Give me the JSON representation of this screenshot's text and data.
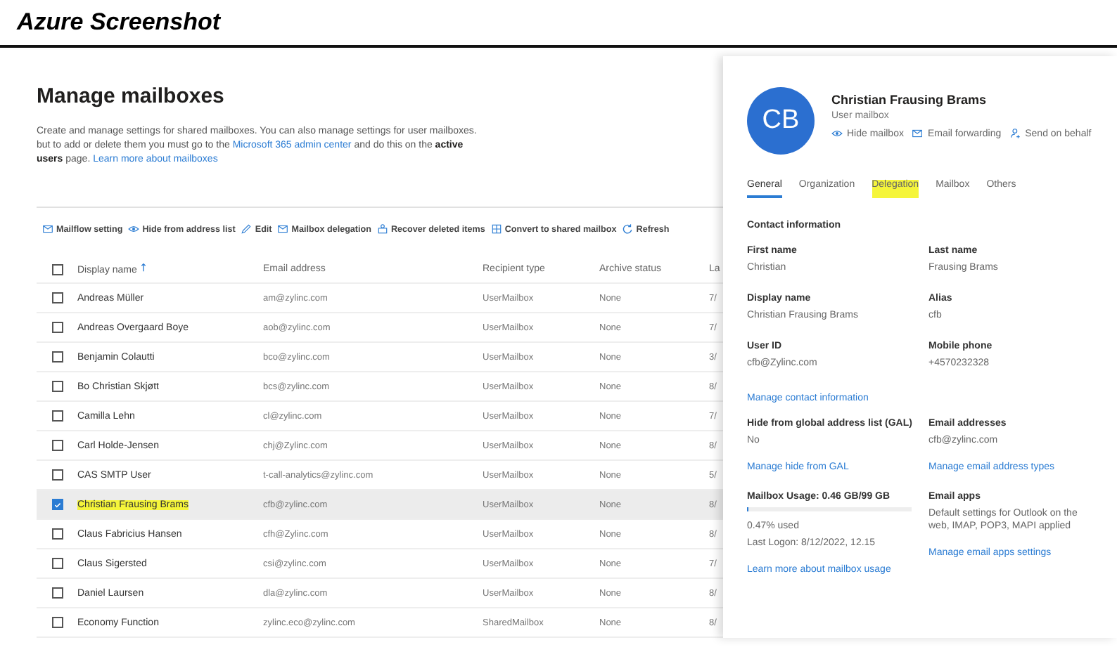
{
  "header": {
    "title": "Azure Screenshot"
  },
  "page": {
    "title": "Manage mailboxes",
    "description": [
      {
        "kind": "text",
        "text": "Create and manage settings for shared mailboxes. You can also manage settings for user mailboxes. but to add or delete them you must go to the "
      },
      {
        "kind": "link",
        "text": "Microsoft 365 admin center"
      },
      {
        "kind": "text",
        "text": " and do this on the **active users** page. "
      },
      {
        "kind": "link",
        "text": "Learn more about mailboxes"
      }
    ]
  },
  "toolbar": [
    {
      "kind": "mailflow",
      "label": "Mailflow setting"
    },
    {
      "kind": "hide",
      "label": "Hide from address list"
    },
    {
      "kind": "edit",
      "label": "Edit"
    },
    {
      "kind": "delegation",
      "label": "Mailbox delegation"
    },
    {
      "kind": "recover",
      "label": "Recover deleted items"
    },
    {
      "kind": "convert",
      "label": "Convert to shared mailbox"
    },
    {
      "kind": "refresh",
      "label": "Refresh"
    }
  ],
  "table": {
    "all_selected": false,
    "columns": [
      {
        "label": "Display name",
        "sorted": true
      },
      {
        "label": "Email address",
        "sorted": false
      },
      {
        "label": "Recipient type",
        "sorted": false
      },
      {
        "label": "Archive status",
        "sorted": false
      },
      {
        "label": "La",
        "sorted": false
      }
    ],
    "rows": [
      {
        "selected": false,
        "highlighted": false,
        "cells": [
          "Andreas Müller",
          "am@zylinc.com",
          "UserMailbox",
          "None",
          "7/"
        ]
      },
      {
        "selected": false,
        "highlighted": false,
        "cells": [
          "Andreas Overgaard Boye",
          "aob@zylinc.com",
          "UserMailbox",
          "None",
          "7/"
        ]
      },
      {
        "selected": false,
        "highlighted": false,
        "cells": [
          "Benjamin Colautti",
          "bco@zylinc.com",
          "UserMailbox",
          "None",
          "3/"
        ]
      },
      {
        "selected": false,
        "highlighted": false,
        "cells": [
          "Bo Christian Skjøtt",
          "bcs@zylinc.com",
          "UserMailbox",
          "None",
          "8/"
        ]
      },
      {
        "selected": false,
        "highlighted": false,
        "cells": [
          "Camilla Lehn",
          "cl@zylinc.com",
          "UserMailbox",
          "None",
          "7/"
        ]
      },
      {
        "selected": false,
        "highlighted": false,
        "cells": [
          "Carl Holde-Jensen",
          "chj@Zylinc.com",
          "UserMailbox",
          "None",
          "8/"
        ]
      },
      {
        "selected": false,
        "highlighted": false,
        "cells": [
          "CAS SMTP User",
          "t-call-analytics@zylinc.com",
          "UserMailbox",
          "None",
          "5/"
        ]
      },
      {
        "selected": true,
        "highlighted": true,
        "cells": [
          "Christian Frausing Brams",
          "cfb@zylinc.com",
          "UserMailbox",
          "None",
          "8/"
        ]
      },
      {
        "selected": false,
        "highlighted": false,
        "cells": [
          "Claus Fabricius Hansen",
          "cfh@Zylinc.com",
          "UserMailbox",
          "None",
          "8/"
        ]
      },
      {
        "selected": false,
        "highlighted": false,
        "cells": [
          "Claus Sigersted",
          "csi@zylinc.com",
          "UserMailbox",
          "None",
          "7/"
        ]
      },
      {
        "selected": false,
        "highlighted": false,
        "cells": [
          "Daniel Laursen",
          "dla@zylinc.com",
          "UserMailbox",
          "None",
          "8/"
        ]
      },
      {
        "selected": false,
        "highlighted": false,
        "cells": [
          "Economy Function",
          "zylinc.eco@zylinc.com",
          "SharedMailbox",
          "None",
          "8/"
        ]
      }
    ]
  },
  "panel": {
    "initials": "CB",
    "name": "Christian Frausing Brams",
    "subtitle": "User mailbox",
    "actions": [
      {
        "kind": "hide",
        "label": "Hide mailbox"
      },
      {
        "kind": "forward",
        "label": "Email forwarding"
      },
      {
        "kind": "behalf",
        "label": "Send on behalf"
      }
    ],
    "tabs": [
      {
        "label": "General",
        "selected": true,
        "highlighted": false
      },
      {
        "label": "Organization",
        "selected": false,
        "highlighted": false
      },
      {
        "label": "Delegation",
        "selected": false,
        "highlighted": true
      },
      {
        "label": "Mailbox",
        "selected": false,
        "highlighted": false
      },
      {
        "label": "Others",
        "selected": false,
        "highlighted": false
      }
    ],
    "section": "Contact information",
    "items": [
      {
        "kind": "pair",
        "fields": [
          {
            "label": "First name",
            "value": "Christian"
          },
          {
            "label": "Last name",
            "value": "Frausing Brams"
          }
        ]
      },
      {
        "kind": "pair",
        "fields": [
          {
            "label": "Display name",
            "value": "Christian Frausing Brams"
          },
          {
            "label": "Alias",
            "value": "cfb"
          }
        ]
      },
      {
        "kind": "pair",
        "fields": [
          {
            "label": "User ID",
            "value": "cfb@Zylinc.com"
          },
          {
            "label": "Mobile phone",
            "value": "+4570232328"
          }
        ]
      },
      {
        "kind": "link",
        "text": "Manage contact information"
      },
      {
        "kind": "pair",
        "fields": [
          {
            "label": "Hide from global address list (GAL)",
            "value": "No",
            "link": "Manage hide from GAL"
          },
          {
            "label": "Email addresses",
            "value": "cfb@zylinc.com",
            "link": "Manage email address types"
          }
        ]
      },
      {
        "kind": "pair",
        "fields": [
          {
            "label": "Mailbox Usage: 0.46 GB/99 GB",
            "level": 0.0047,
            "value": "0.47% used",
            "note": "Last Logon: 8/12/2022, 12.15",
            "link": "Learn more about mailbox usage"
          },
          {
            "label": "Email apps",
            "value": "Default settings for Outlook on the web, IMAP, POP3, MAPI applied",
            "link": "Manage email apps settings"
          }
        ]
      }
    ]
  }
}
